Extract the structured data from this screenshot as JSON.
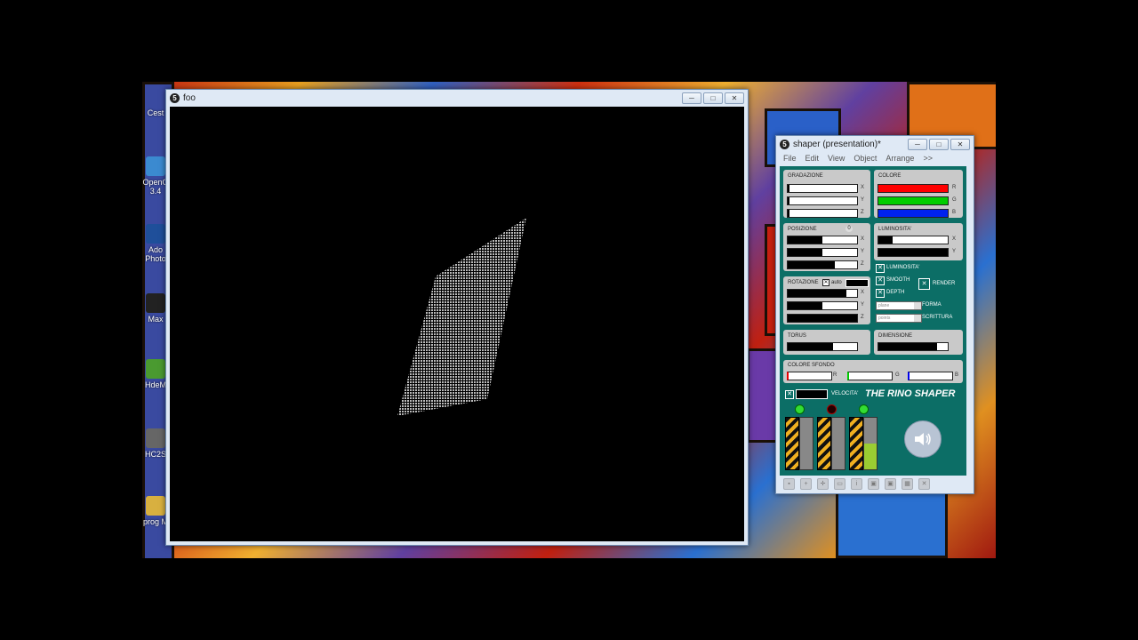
{
  "desktop": {
    "icons": [
      {
        "label": "Cest",
        "color": "#9aa"
      },
      {
        "label": "OpenO 3.4",
        "color": "#3b8ad0"
      },
      {
        "label": "Ado Photo",
        "color": "#1f4f9a"
      },
      {
        "label": "Max",
        "color": "#222"
      },
      {
        "label": "HdeM",
        "color": "#4a9a30"
      },
      {
        "label": "HC2S",
        "color": "#666"
      },
      {
        "label": "prog M",
        "color": "#d8b040"
      }
    ]
  },
  "foo_window": {
    "title": "foo",
    "buttons": [
      "─",
      "□",
      "✕"
    ]
  },
  "shaper_window": {
    "title": "shaper (presentation)*",
    "buttons": [
      "─",
      "□",
      "✕"
    ],
    "menu": [
      "File",
      "Edit",
      "View",
      "Object",
      "Arrange",
      ">>"
    ],
    "gradazione": {
      "label": "GRADAZIONE",
      "axes": [
        "X",
        "Y",
        "Z"
      ]
    },
    "colore": {
      "label": "COLORE",
      "axes": [
        "R",
        "G",
        "B"
      ],
      "colors": [
        "#ff0000",
        "#00cc00",
        "#0022ee"
      ]
    },
    "posizione": {
      "label": "POSIZIONE",
      "reset": "0",
      "axes": [
        "X",
        "Y",
        "Z"
      ]
    },
    "luminosita": {
      "label": "LUMINOSITA'",
      "axes": [
        "X",
        "Y"
      ]
    },
    "checks": {
      "luminosita": "LUMINOSITA'",
      "smooth": "SMOOTH",
      "depth": "DEPTH",
      "render": "RENDER"
    },
    "rotazione": {
      "label": "ROTAZIONE",
      "auto": "auto",
      "axes": [
        "X",
        "Y",
        "Z"
      ]
    },
    "forma": {
      "label": "FORMA",
      "value": "plane"
    },
    "scrittura": {
      "label": "SCRITTURA",
      "value": "points"
    },
    "torus": {
      "label": "TORUS"
    },
    "dimensione": {
      "label": "DIMENSIONE"
    },
    "colore_sfondo": {
      "label": "COLORE SFONDO",
      "axes": [
        "R",
        "G",
        "B"
      ]
    },
    "velocita": {
      "label": "VELOCITA'"
    },
    "brand": "THE RINO SHAPER",
    "leds": [
      "#33dd33",
      "#220000",
      "#33dd33"
    ]
  }
}
